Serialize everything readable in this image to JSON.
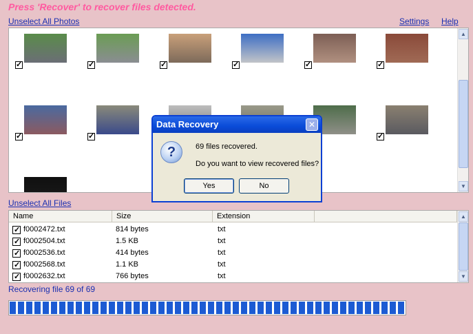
{
  "banner": "Press 'Recover' to recover files detected.",
  "links": {
    "unselect_photos": "Unselect All Photos",
    "settings": "Settings",
    "help": "Help",
    "unselect_files": "Unselect All Files"
  },
  "photos": [
    {
      "color_top": "#5a8c4a",
      "color_bottom": "#6b6e76",
      "checked": true
    },
    {
      "color_top": "#6b9d54",
      "color_bottom": "#8a8d92",
      "checked": true
    },
    {
      "color_top": "#c9a07a",
      "color_bottom": "#7d6a5a",
      "checked": true
    },
    {
      "color_top": "#3e6fc4",
      "color_bottom": "#c2c4c8",
      "checked": true
    },
    {
      "color_top": "#7d5f55",
      "color_bottom": "#b09080",
      "checked": true
    },
    {
      "color_top": "#8a4a3a",
      "color_bottom": "#a06a55",
      "checked": true
    },
    {
      "color_top": "#4a6aa0",
      "color_bottom": "#8c5a60",
      "checked": true
    },
    {
      "color_top": "#8a8a7a",
      "color_bottom": "#3a4a8a",
      "checked": true
    },
    {
      "color_top": "#bdbdbd",
      "color_bottom": "#7a7a7a",
      "checked": false
    },
    {
      "color_top": "#9a9a8a",
      "color_bottom": "#6a6a5a",
      "checked": false
    },
    {
      "color_top": "#4e6d4a",
      "color_bottom": "#8f8f88",
      "checked": false
    },
    {
      "color_top": "#8a8070",
      "color_bottom": "#5a5a60",
      "checked": true
    },
    {
      "color_top": "#101010",
      "color_bottom": "#1c1c1c",
      "checked": false
    }
  ],
  "files": {
    "columns": [
      "Name",
      "Size",
      "Extension"
    ],
    "rows": [
      {
        "name": "f0002472.txt",
        "size": "814 bytes",
        "ext": "txt",
        "checked": true
      },
      {
        "name": "f0002504.txt",
        "size": "1.5 KB",
        "ext": "txt",
        "checked": true
      },
      {
        "name": "f0002536.txt",
        "size": "414 bytes",
        "ext": "txt",
        "checked": true
      },
      {
        "name": "f0002568.txt",
        "size": "1.1 KB",
        "ext": "txt",
        "checked": true
      },
      {
        "name": "f0002632.txt",
        "size": "766 bytes",
        "ext": "txt",
        "checked": true
      }
    ]
  },
  "status": "Recovering file 69 of 69",
  "progress": 1.0,
  "dialog": {
    "title": "Data Recovery",
    "close_glyph": "✕",
    "icon_glyph": "?",
    "message1": "69 files recovered.",
    "message2": "Do you want to view recovered files?",
    "yes": "Yes",
    "no": "No"
  },
  "colors": {
    "accent": "#0a3fd3",
    "link": "#1a2fb0",
    "banner": "#ff5ba0",
    "progress": "#1c5bd3",
    "background": "#e8c3c8"
  }
}
